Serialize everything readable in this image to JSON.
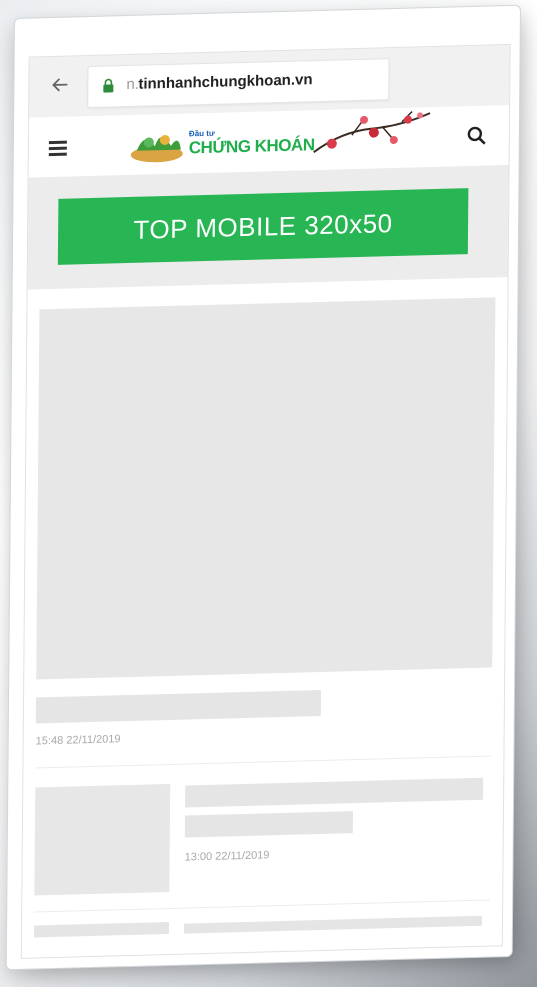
{
  "browser": {
    "url_prefix": "n.",
    "url_host": "tinnhanhchungkhoan.vn"
  },
  "header": {
    "logo_small": "Đầu tư",
    "logo_main": "CHỨNG KHOÁN",
    "icons": [
      "back-arrow-icon",
      "lock-icon",
      "hamburger-menu-icon",
      "search-icon"
    ]
  },
  "ad": {
    "label": "TOP MOBILE  320x50",
    "color": "#28b554"
  },
  "articles": [
    {
      "timestamp": "15:48 22/11/2019"
    },
    {
      "timestamp": "13:00 22/11/2019"
    }
  ],
  "colors": {
    "accent_green": "#1fae4b",
    "placeholder_gray": "#e7e7e7"
  }
}
